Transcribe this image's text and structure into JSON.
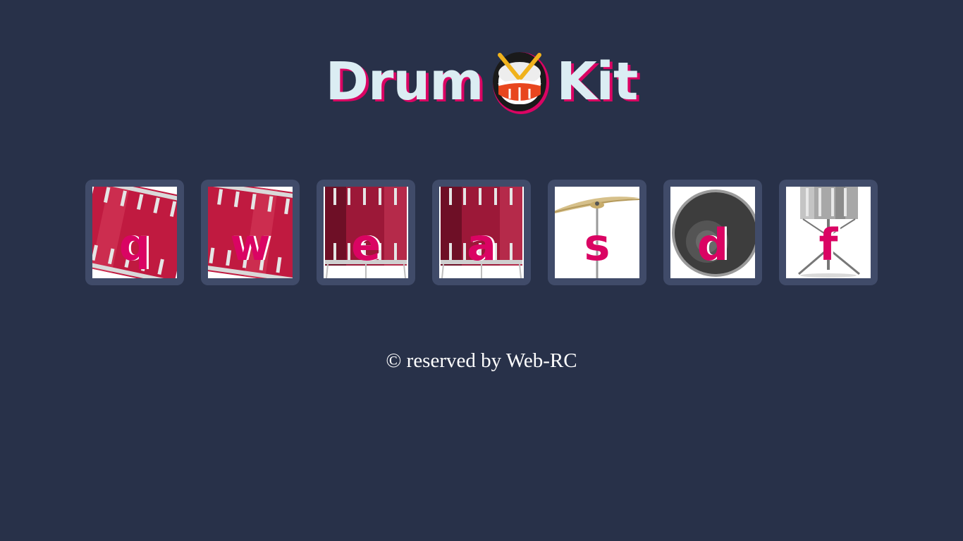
{
  "title": {
    "left_word": "Drum",
    "right_word": "Kit",
    "emoji_icon": "drum-emoji-icon"
  },
  "colors": {
    "background": "#283149",
    "button_frame": "#404b69",
    "title_text": "#dbedf3",
    "accent": "#da0463"
  },
  "drums": [
    {
      "key": "q",
      "icon": "tom-drum-image"
    },
    {
      "key": "w",
      "icon": "tom-drum-image"
    },
    {
      "key": "e",
      "icon": "floor-tom-image"
    },
    {
      "key": "a",
      "icon": "floor-tom-image"
    },
    {
      "key": "s",
      "icon": "cymbal-image"
    },
    {
      "key": "d",
      "icon": "bass-drum-image"
    },
    {
      "key": "f",
      "icon": "snare-drum-image"
    }
  ],
  "footer": {
    "text": "© reserved by Web-RC"
  }
}
